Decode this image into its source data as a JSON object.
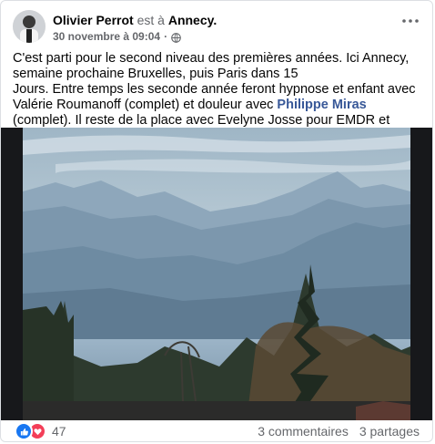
{
  "post": {
    "author": "Olivier Perrot",
    "at_text": "est à",
    "place": "Annecy.",
    "timestamp": "30 novembre à 09:04",
    "separator": "·",
    "privacy_icon": "globe-icon",
    "text_line1": "C'est parti pour le second niveau des premières années. Ici Annecy, semaine prochaine Bruxelles, puis Paris dans 15",
    "text_line2": "Jours. Entre temps les seconde année feront hypnose et enfant avec Valérie Roumanoff (complet) et douleur avec ",
    "mention": "Philippe Miras",
    "text_line2_end": " (complet). Il reste de la place avec Evelyne Josse pour EMDR et CIAM."
  },
  "footer": {
    "reaction_icons": [
      "like-icon",
      "love-icon"
    ],
    "reaction_count": "47",
    "comments": "3 commentaires",
    "shares": "3 partages"
  },
  "colors": {
    "link": "#385898",
    "muted": "#65676b",
    "like": "#1877f2",
    "love": "#f33e58"
  }
}
